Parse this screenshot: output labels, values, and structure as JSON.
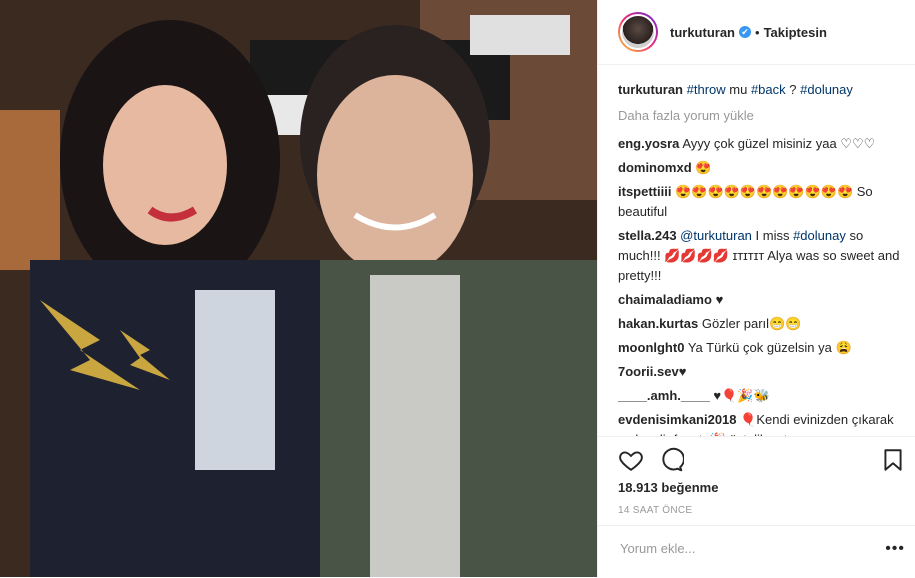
{
  "post": {
    "username": "turkuturan",
    "verified_mark": "✔",
    "dot": "•",
    "follow_label": "Takiptesin",
    "load_more": "Daha fazla yorum yükle",
    "likes": "18.913 beğenme",
    "timestamp": "14 SAAT ÖNCE",
    "comment_placeholder": "Yorum ekle...",
    "options": "•••"
  },
  "caption": {
    "user": "turkuturan",
    "tag1": "#throw",
    "mid": " mu ",
    "tag2": "#back",
    "q": " ? ",
    "tag3": "#dolunay"
  },
  "comments": [
    {
      "user": "eng.yosra",
      "text": "Ayyy çok güzel misiniz yaa ♡♡♡"
    },
    {
      "user": "dominomxd",
      "text": "😍"
    },
    {
      "user": "itspettiiii",
      "text": "😍😍😍😍😍😍😍😍😍😍😍 So beautiful"
    },
    {
      "user": "stella.243",
      "mention": "@turkuturan",
      "text1": " I miss ",
      "tag": "#dolunay",
      "text2": " so much!!! 💋💋💋💋 ɪᴛɪᴛɪᴛ Alya was so sweet and pretty!!!"
    },
    {
      "user": "chaimaladiamo",
      "text": "♥"
    },
    {
      "user": "hakan.kurtas",
      "text": "Gözler parıl😁😁"
    },
    {
      "user": "moonlght0",
      "text": "Ya Türkü çok güzelsin ya 😩"
    },
    {
      "user": "7oorii.sev",
      "text": "♥"
    },
    {
      "user": "____.amh.____",
      "text": "♥🎈🎉🐝"
    },
    {
      "user": "evdenisimkani2018",
      "text": "🎈Kendi evinizden çıkarak ayık gelir fırsatı 🎉 üstelik satış"
    }
  ],
  "icons": {
    "heart": "heart-icon",
    "comment": "comment-icon",
    "bookmark": "bookmark-icon"
  },
  "colors": {
    "link": "#003569",
    "verified": "#3897f0",
    "muted": "#999999"
  }
}
